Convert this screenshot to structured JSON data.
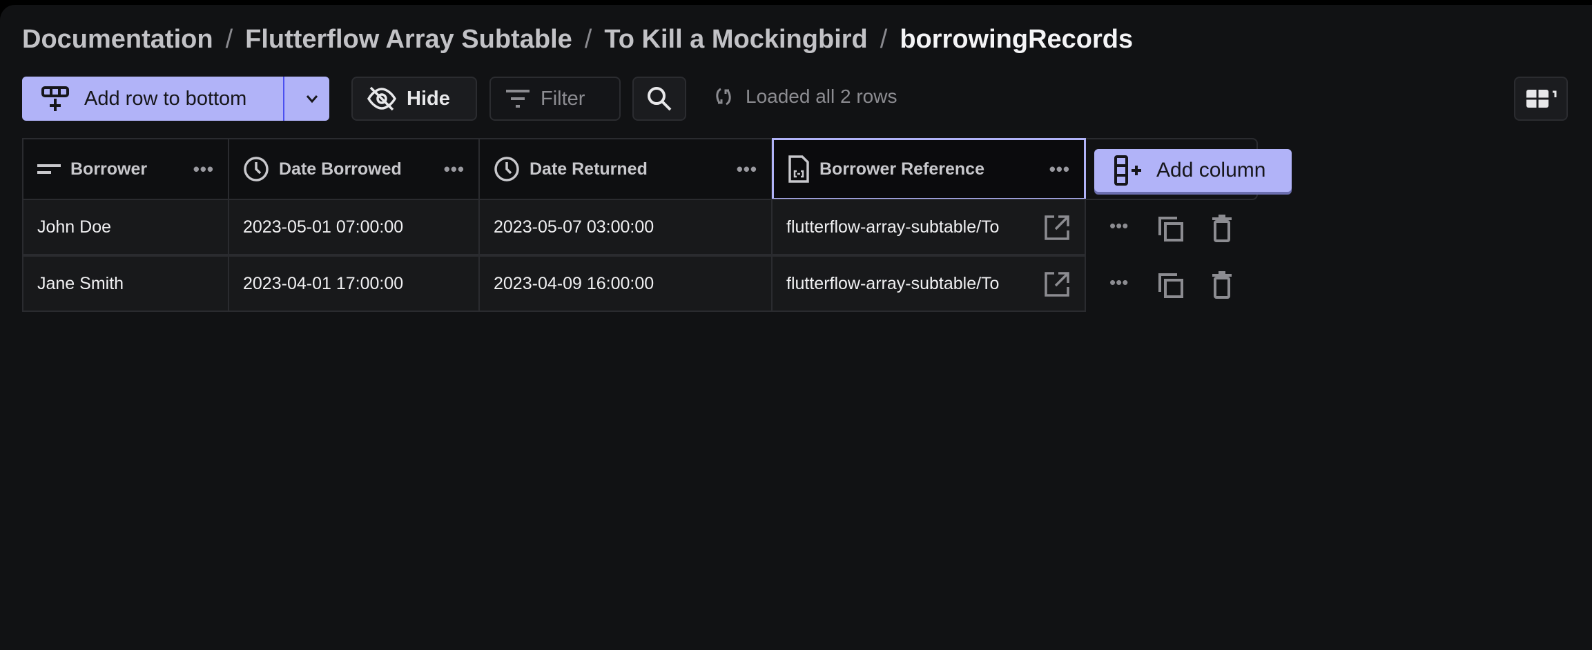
{
  "breadcrumb": [
    "Documentation",
    "Flutterflow Array Subtable",
    "To Kill a Mockingbird",
    "borrowingRecords"
  ],
  "toolbar": {
    "add_row_label": "Add row to bottom",
    "hide_label": "Hide",
    "filter_label": "Filter",
    "status": "Loaded all 2 rows"
  },
  "columns": [
    {
      "label": "Borrower",
      "icon": "text-icon"
    },
    {
      "label": "Date Borrowed",
      "icon": "clock-icon"
    },
    {
      "label": "Date Returned",
      "icon": "clock-icon"
    },
    {
      "label": "Borrower Reference",
      "icon": "file-link-icon"
    }
  ],
  "add_column_label": "Add column",
  "rows": [
    [
      "John Doe",
      "2023-05-01 07:00:00",
      "2023-05-07 03:00:00",
      "flutterflow-array-subtable/To"
    ],
    [
      "Jane Smith",
      "2023-04-01 17:00:00",
      "2023-04-09 16:00:00",
      "flutterflow-array-subtable/To"
    ]
  ],
  "colors": {
    "accent": "#b1b3f8",
    "background": "#111214"
  }
}
